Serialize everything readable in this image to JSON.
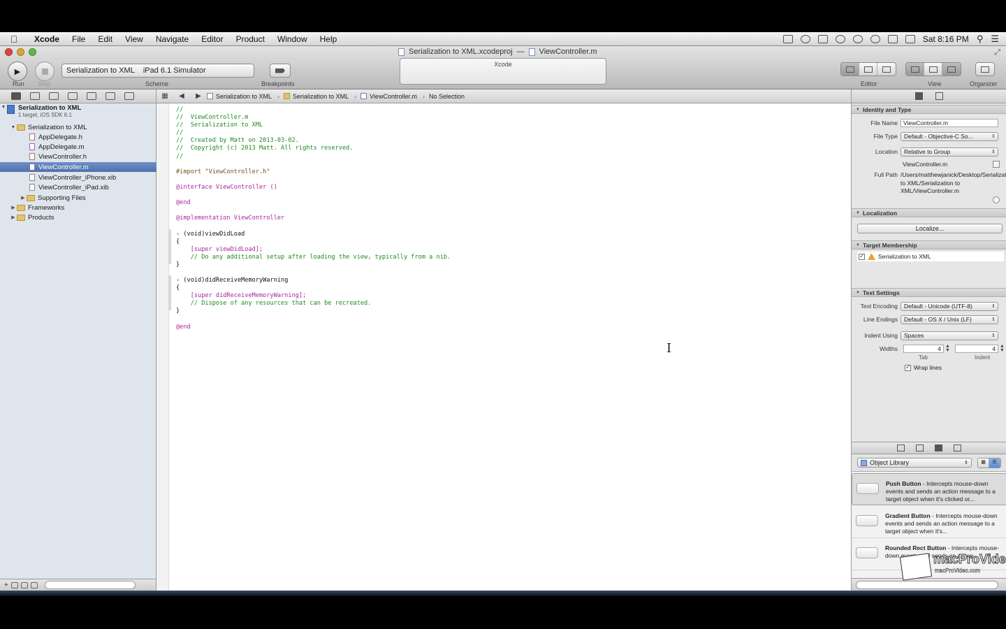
{
  "menubar": {
    "app_name": "Xcode",
    "items": [
      "File",
      "Edit",
      "View",
      "Navigate",
      "Editor",
      "Product",
      "Window",
      "Help"
    ],
    "clock": "Sat 8:16 PM"
  },
  "window": {
    "title_project": "Serialization to XML.xcodeproj",
    "title_separator": "—",
    "title_file": "ViewController.m"
  },
  "toolbar": {
    "run_label": "Run",
    "stop_label": "Stop",
    "scheme_label": "Scheme",
    "scheme_target": "Serialization to XML",
    "scheme_destination": "iPad 6.1 Simulator",
    "breakpoints_label": "Breakpoints",
    "activity_text": "Xcode",
    "editor_label": "Editor",
    "view_label": "View",
    "organizer_label": "Organizer"
  },
  "navigator": {
    "project_name": "Serialization to XML",
    "project_subtitle": "1 target, iOS SDK 6.1",
    "group_name": "Serialization to XML",
    "files": [
      "AppDelegate.h",
      "AppDelegate.m",
      "ViewController.h",
      "ViewController.m",
      "ViewController_iPhone.xib",
      "ViewController_iPad.xib"
    ],
    "supporting_files": "Supporting Files",
    "frameworks": "Frameworks",
    "products": "Products"
  },
  "jumpbar": {
    "crumbs": [
      "Serialization to XML",
      "Serialization to XML",
      "ViewController.m",
      "No Selection"
    ]
  },
  "code_lines": [
    {
      "cls": "c-comment",
      "text": "//"
    },
    {
      "cls": "c-comment",
      "text": "//  ViewController.m"
    },
    {
      "cls": "c-comment",
      "text": "//  Serialization to XML"
    },
    {
      "cls": "c-comment",
      "text": "//"
    },
    {
      "cls": "c-comment",
      "text": "//  Created by Matt on 2013-03-02."
    },
    {
      "cls": "c-comment",
      "text": "//  Copyright (c) 2013 Matt. All rights reserved."
    },
    {
      "cls": "c-comment",
      "text": "//"
    },
    {
      "cls": "",
      "text": ""
    },
    {
      "cls": "c-directive",
      "text": "#import \"ViewController.h\""
    },
    {
      "cls": "",
      "text": ""
    },
    {
      "cls": "c-keyword",
      "text": "@interface ViewController ()"
    },
    {
      "cls": "",
      "text": ""
    },
    {
      "cls": "c-keyword",
      "text": "@end"
    },
    {
      "cls": "",
      "text": ""
    },
    {
      "cls": "c-keyword",
      "text": "@implementation ViewController"
    },
    {
      "cls": "",
      "text": ""
    },
    {
      "cls": "",
      "text": "- (void)viewDidLoad"
    },
    {
      "cls": "",
      "text": "{"
    },
    {
      "cls": "c-keyword",
      "text": "    [super viewDidLoad];"
    },
    {
      "cls": "c-comment",
      "text": "    // Do any additional setup after loading the view, typically from a nib."
    },
    {
      "cls": "",
      "text": "}"
    },
    {
      "cls": "",
      "text": ""
    },
    {
      "cls": "",
      "text": "- (void)didReceiveMemoryWarning"
    },
    {
      "cls": "",
      "text": "{"
    },
    {
      "cls": "c-keyword",
      "text": "    [super didReceiveMemoryWarning];"
    },
    {
      "cls": "c-comment",
      "text": "    // Dispose of any resources that can be recreated."
    },
    {
      "cls": "",
      "text": "}"
    },
    {
      "cls": "",
      "text": ""
    },
    {
      "cls": "c-keyword",
      "text": "@end"
    }
  ],
  "inspector": {
    "identity_header": "Identity and Type",
    "file_name_label": "File Name",
    "file_name_value": "ViewController.m",
    "file_type_label": "File Type",
    "file_type_value": "Default - Objective-C So...",
    "location_label": "Location",
    "location_value": "Relative to Group",
    "location_file": "ViewController.m",
    "full_path_label": "Full Path",
    "full_path_value": "/Users/matthewjanick/Desktop/Serialization to XML/Serialization to XML/ViewController.m",
    "localization_header": "Localization",
    "localize_button": "Localize...",
    "target_header": "Target Membership",
    "target_name": "Serialization to XML",
    "text_settings_header": "Text Settings",
    "encoding_label": "Text Encoding",
    "encoding_value": "Default - Unicode (UTF-8)",
    "line_endings_label": "Line Endings",
    "line_endings_value": "Default - OS X / Unix (LF)",
    "indent_using_label": "Indent Using",
    "indent_using_value": "Spaces",
    "widths_label": "Widths",
    "tab_width": "4",
    "indent_width": "4",
    "tab_caption": "Tab",
    "indent_caption": "Indent",
    "wrap_lines_label": "Wrap lines"
  },
  "library": {
    "popup_label": "Object Library",
    "items": [
      {
        "name": "Push Button",
        "desc": " - Intercepts mouse-down events and sends an action message to a target object when it's clicked or..."
      },
      {
        "name": "Gradient Button",
        "desc": " - Intercepts mouse-down events and sends an action message to a target object when it's..."
      },
      {
        "name": "Rounded Rect Button",
        "desc": " - Intercepts mouse-down events and sends an action..."
      }
    ]
  },
  "watermark": {
    "brand": "macProVideo",
    "sub": "macProVideo.com"
  }
}
